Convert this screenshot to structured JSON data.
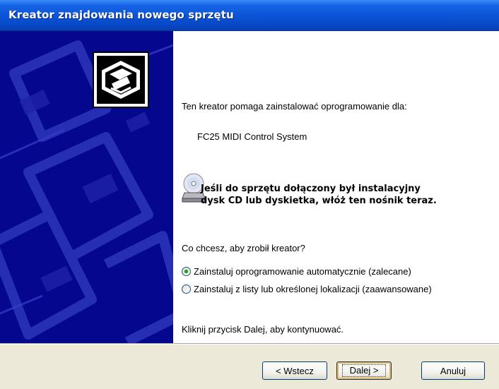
{
  "window": {
    "title": "Kreator znajdowania nowego sprzętu"
  },
  "content": {
    "intro": "Ten kreator pomaga zainstalować oprogramowanie dla:",
    "device_name": "FC25 MIDI Control System",
    "cd_message_line1": "Jeśli do sprzętu dołączony był instalacyjny",
    "cd_message_line2": "dysk CD lub dyskietka, włóż ten nośnik teraz.",
    "question": "Co chcesz, aby zrobił kreator?",
    "options": [
      {
        "label": "Zainstaluj oprogramowanie automatycznie (zalecane)",
        "selected": true
      },
      {
        "label": "Zainstaluj z listy lub określonej lokalizacji (zaawansowane)",
        "selected": false
      }
    ],
    "continue_hint": "Kliknij przycisk Dalej, aby kontynuować."
  },
  "buttons": {
    "back": "< Wstecz",
    "next": "Dalej >",
    "cancel": "Anuluj"
  },
  "icons": {
    "hardware": "hardware-wizard-icon",
    "cd": "cd-drive-icon"
  },
  "colors": {
    "titlebar": "#0a53d6",
    "sidebar": "#06078f",
    "footer": "#ece9d8",
    "radio_dot": "#21a121"
  }
}
